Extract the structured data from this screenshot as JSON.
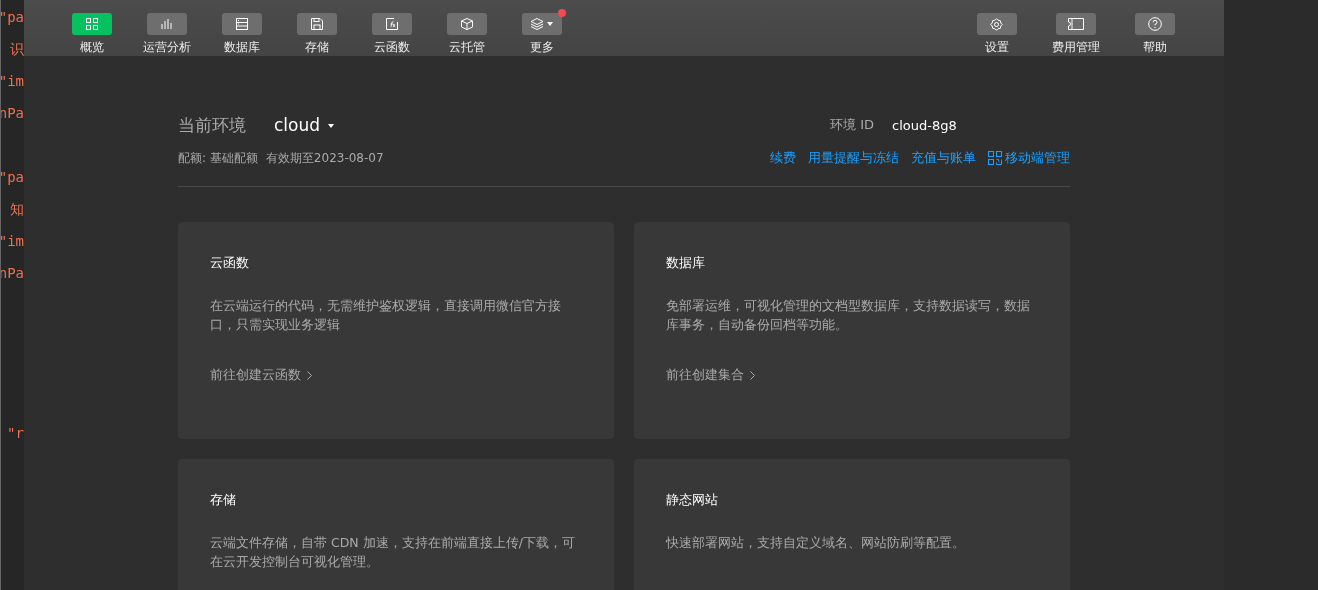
{
  "editor_fragments": [
    "\"pa",
    "识",
    "\"im",
    "nPa",
    "\"pa",
    "知",
    "\"im",
    "nPa",
    "\"r"
  ],
  "toolbar_left": [
    {
      "label": "概览",
      "selected": true,
      "badge": false
    },
    {
      "label": "运营分析",
      "selected": false,
      "badge": false
    },
    {
      "label": "数据库",
      "selected": false,
      "badge": false
    },
    {
      "label": "存储",
      "selected": false,
      "badge": false
    },
    {
      "label": "云函数",
      "selected": false,
      "badge": false
    },
    {
      "label": "云托管",
      "selected": false,
      "badge": false
    },
    {
      "label": "更多",
      "selected": false,
      "badge": true
    }
  ],
  "toolbar_right": [
    {
      "label": "设置"
    },
    {
      "label": "费用管理"
    },
    {
      "label": "帮助"
    }
  ],
  "environment": {
    "label": "当前环境",
    "value": "cloud",
    "id_label": "环境 ID",
    "id_value": "cloud-8g8",
    "quota": "配额: 基础配额",
    "expiry": "有效期至2023-08-07"
  },
  "links": [
    {
      "label": "续费",
      "icon": false
    },
    {
      "label": "用量提醒与冻结",
      "icon": false
    },
    {
      "label": "充值与账单",
      "icon": false
    },
    {
      "label": "移动端管理",
      "icon": true
    }
  ],
  "cards": [
    {
      "title": "云函数",
      "description": "在云端运行的代码，无需维护鉴权逻辑，直接调用微信官方接口，只需实现业务逻辑",
      "action": "前往创建云函数"
    },
    {
      "title": "数据库",
      "description": "免部署运维，可视化管理的文档型数据库，支持数据读写，数据库事务，自动备份回档等功能。",
      "action": "前往创建集合"
    },
    {
      "title": "存储",
      "description": "云端文件存储，自带 CDN 加速，支持在前端直接上传/下载，可在云开发控制台可视化管理。"
    },
    {
      "title": "静态网站",
      "description": "快速部署网站，支持自定义域名、网站防刷等配置。"
    }
  ]
}
